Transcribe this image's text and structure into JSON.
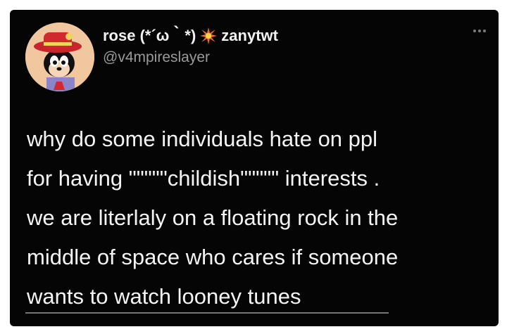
{
  "tweet": {
    "display_name": "rose (*´ω｀*)",
    "badge_text": "zanytwt",
    "handle": "@v4mpireslayer",
    "more_icon": "more-horizontal-icon",
    "spark_icon": "collision-spark-icon",
    "avatar": "cartoon-avatar",
    "text_lines": [
      "why do some individuals hate on ppl",
      "for having \"\"\"\"\"childish\"\"\"\"\" interests .",
      "we are literlaly on a floating rock in the",
      "middle of space who cares if someone",
      "wants to watch looney tunes"
    ]
  },
  "colors": {
    "background": "#050505",
    "text": "#f4f4f4",
    "handle": "#9a9a9a"
  }
}
